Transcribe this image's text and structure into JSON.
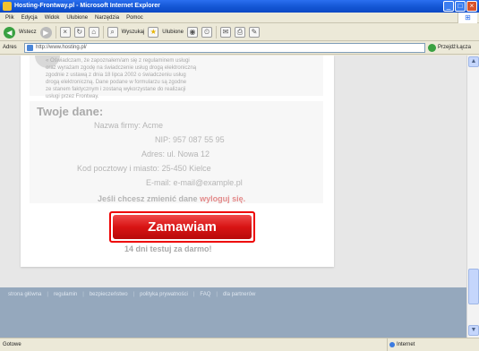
{
  "window": {
    "title": "Hosting-Frontway.pl - Microsoft Internet Explorer",
    "minimize": "_",
    "maximize": "□",
    "close": "×"
  },
  "menu": [
    "Plik",
    "Edycja",
    "Widok",
    "Ulubione",
    "Narzędzia",
    "Pomoc"
  ],
  "toolbar": {
    "back_label": "Wstecz",
    "search_label": "Wyszukaj",
    "favorites_label": "Ulubione"
  },
  "address": {
    "label": "Adres",
    "url": "http://www.hosting.pl/",
    "go_label": "Przejdź",
    "links_label": "Łącza"
  },
  "terms": {
    "lines": [
      "« Oświadczam, że zapoznałem/am się z regulaminem usługi",
      "oraz wyrażam zgodę na świadczenie usług drogą elektroniczną",
      "zgodnie z ustawą z dnia 18 lipca 2002 o świadczeniu usług",
      "drogą elektroniczną. Dane podane w formularzu są zgodne",
      "ze stanem faktycznym i zostaną wykorzystane do realizacji",
      "usługi przez Frontway."
    ]
  },
  "data": {
    "title": "Twoje dane:",
    "company_label": "Nazwa firmy:",
    "company_value": "Acme",
    "nip_label": "NIP:",
    "nip_value": "957 087 55 95",
    "address_label": "Adres:",
    "address_value": "ul. Nowa 12",
    "zip_label": "Kod pocztowy i miasto:",
    "zip_value": "25-450 Kielce",
    "email_label": "E-mail:",
    "email_value": "e-mail@example.pl",
    "change_text": "Jeśli chcesz zmienić dane",
    "logout_link": "wyloguj się.",
    "change_suffix": ""
  },
  "order": {
    "button_label": "Zamawiam",
    "trial_text": "14 dni testuj za darmo!"
  },
  "footer": {
    "links": [
      "strona główna",
      "regulamin",
      "bezpieczeństwo",
      "polityka prywatności",
      "FAQ",
      "dla partnerów"
    ]
  },
  "status": {
    "left": "Gotowe",
    "zone": "Internet"
  },
  "colors": {
    "order_button": "#d81414",
    "order_border": "#ee0000",
    "footer_bg": "#95a8bd",
    "logout_link": "#e38a8a"
  }
}
